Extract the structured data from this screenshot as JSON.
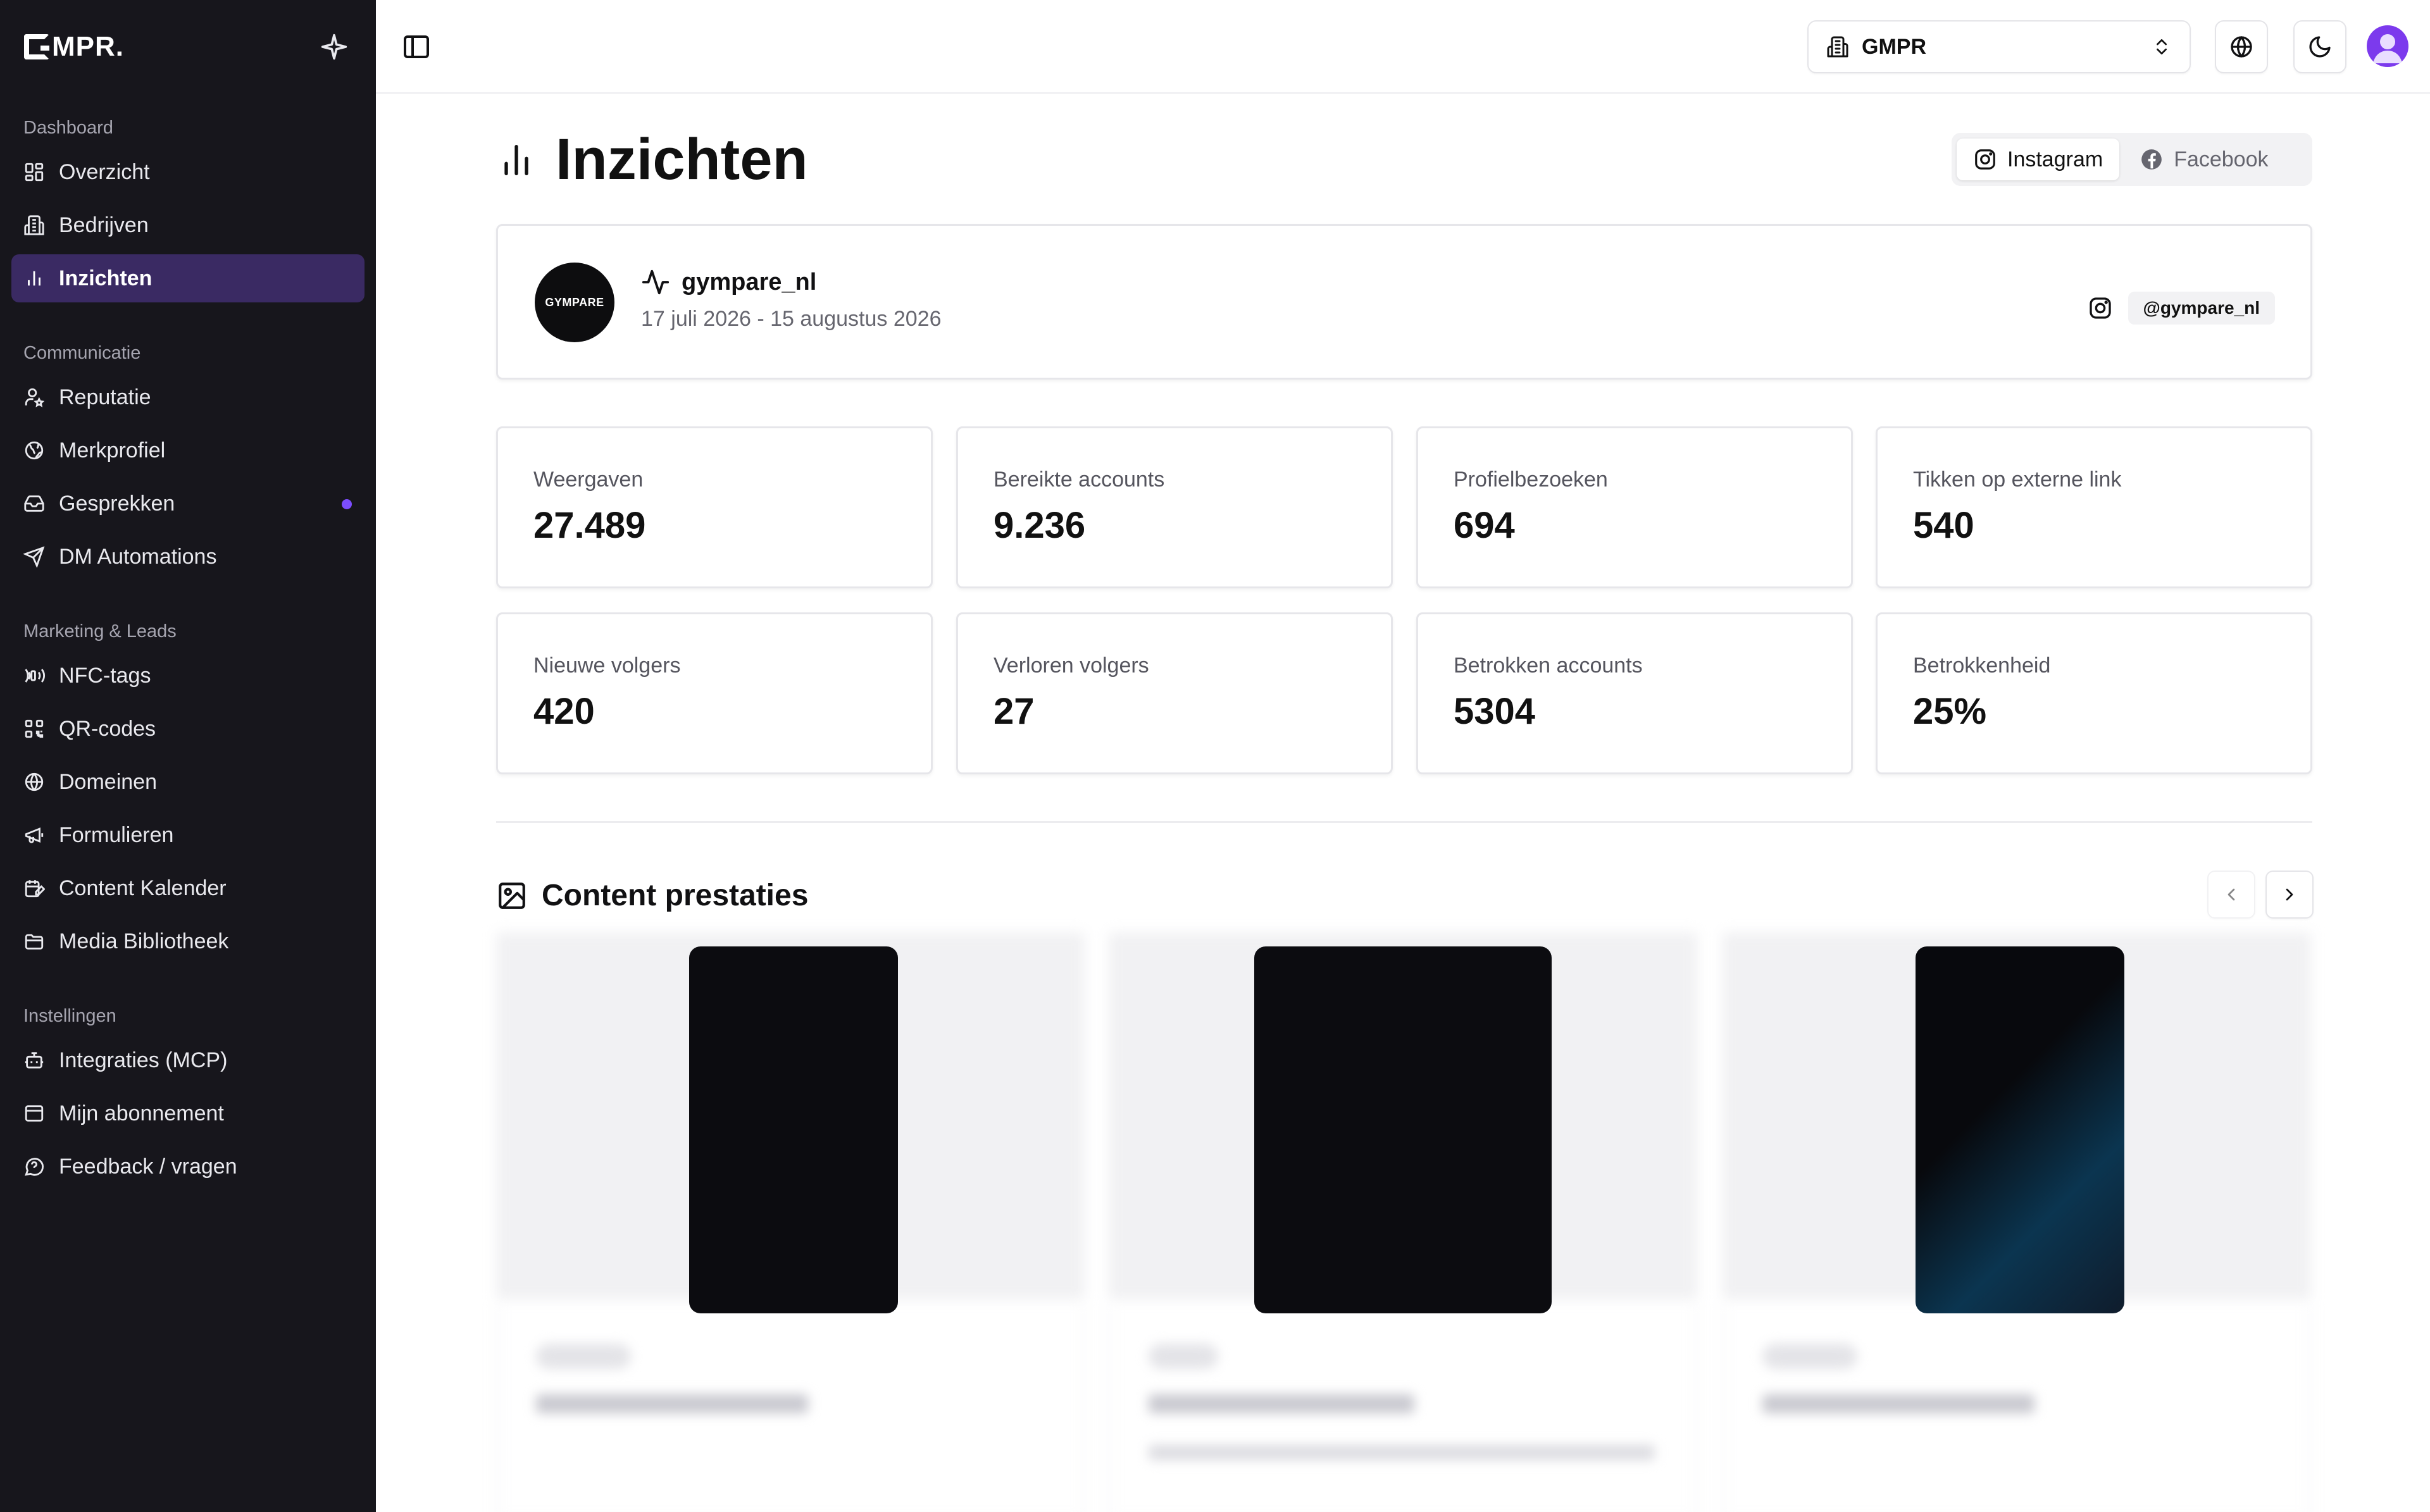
{
  "app": {
    "logo_text": "MPR.",
    "org_selector": {
      "value": "GMPR"
    }
  },
  "sidebar": {
    "groups": [
      {
        "label": "Dashboard",
        "items": [
          {
            "label": "Overzicht",
            "icon": "grid-icon"
          },
          {
            "label": "Bedrijven",
            "icon": "building-icon"
          },
          {
            "label": "Inzichten",
            "icon": "bar-chart-icon",
            "active": true
          }
        ]
      },
      {
        "label": "Communicatie",
        "items": [
          {
            "label": "Reputatie",
            "icon": "user-star-icon"
          },
          {
            "label": "Merkprofiel",
            "icon": "brand-globe-icon"
          },
          {
            "label": "Gesprekken",
            "icon": "inbox-icon",
            "badge_dot": true
          },
          {
            "label": "DM Automations",
            "icon": "send-icon"
          }
        ]
      },
      {
        "label": "Marketing & Leads",
        "items": [
          {
            "label": "NFC-tags",
            "icon": "nfc-icon"
          },
          {
            "label": "QR-codes",
            "icon": "qr-icon"
          },
          {
            "label": "Domeinen",
            "icon": "globe-icon"
          },
          {
            "label": "Formulieren",
            "icon": "megaphone-icon"
          },
          {
            "label": "Content Kalender",
            "icon": "calendar-edit-icon"
          },
          {
            "label": "Media Bibliotheek",
            "icon": "folder-icon"
          }
        ]
      },
      {
        "label": "Instellingen",
        "items": [
          {
            "label": "Integraties (MCP)",
            "icon": "robot-icon"
          },
          {
            "label": "Mijn abonnement",
            "icon": "card-icon"
          },
          {
            "label": "Feedback / vragen",
            "icon": "help-chat-icon"
          }
        ]
      }
    ]
  },
  "page": {
    "title": "Inzichten",
    "platform_tabs": [
      {
        "label": "Instagram",
        "active": true
      },
      {
        "label": "Facebook",
        "active": false
      }
    ],
    "profile": {
      "avatar_text": "GYMPARE",
      "name": "gympare_nl",
      "date_range": "17 juli 2026 - 15 augustus 2026",
      "handle": "@gympare_nl"
    },
    "stats": [
      {
        "label": "Weergaven",
        "value": "27.489"
      },
      {
        "label": "Bereikte accounts",
        "value": "9.236"
      },
      {
        "label": "Profielbezoeken",
        "value": "694"
      },
      {
        "label": "Tikken op externe link",
        "value": "540"
      },
      {
        "label": "Nieuwe volgers",
        "value": "420"
      },
      {
        "label": "Verloren volgers",
        "value": "27"
      },
      {
        "label": "Betrokken accounts",
        "value": "5304"
      },
      {
        "label": "Betrokkenheid",
        "value": "25%"
      }
    ],
    "content_section": {
      "title": "Content prestaties"
    }
  },
  "colors": {
    "sidebar_bg": "#17161c",
    "active_item_bg": "#3a2a63",
    "accent": "#7c3aed",
    "badge_dot": "#7c4dff"
  }
}
